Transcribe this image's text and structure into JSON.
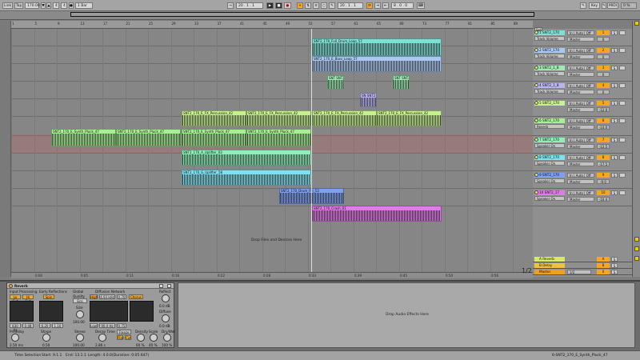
{
  "transport": {
    "link": "Link",
    "tap": "Tap",
    "tempo": "170.00",
    "sig_num": "4",
    "sig_den": "4",
    "quantize": "1 Bar",
    "position": "20 . 1 . 1",
    "loop_start": "20 . 1 . 1",
    "loop_len": "8 . 0 . 0",
    "key": "Key",
    "midi": "MIDI",
    "cpu": "0 %"
  },
  "ruler": {
    "bars": [
      "1",
      "5",
      "9",
      "13",
      "17",
      "21",
      "25",
      "29",
      "33",
      "37",
      "41",
      "45",
      "49",
      "53",
      "57",
      "61",
      "65",
      "69",
      "73",
      "77",
      "81",
      "85",
      "89"
    ],
    "times": [
      "0:00",
      "0:05",
      "0:11",
      "0:16",
      "0:22",
      "0:28",
      "0:33",
      "0:39",
      "0:45",
      "0:50",
      "0:56"
    ]
  },
  "clips": [
    {
      "name": "SNT2_170_Full_Drum_Loop_57",
      "color": "#7de0d4",
      "waveform": true
    },
    {
      "name": "SNT2_170_E_Bass_Loop_57",
      "color": "#a8c8f0",
      "waveform": true
    },
    {
      "name": "SNT SNT2",
      "color": "#9ee9b0",
      "waveform": true
    },
    {
      "name": "SNT SNT2",
      "color": "#9ee9b0",
      "waveform": true
    },
    {
      "name": "SN SNT2",
      "color": "#b7b4f0",
      "waveform": true
    },
    {
      "name": "SNT2_170_E_FX_Percussion_42",
      "color": "#c7f08e",
      "waveform": true
    },
    {
      "name": "SNT2_170_E_FX_Percussion_42",
      "color": "#c7f08e",
      "waveform": true
    },
    {
      "name": "SNT2_170_E_FX_Percussion_42",
      "color": "#c7f08e",
      "waveform": true
    },
    {
      "name": "SNT2_170_E_FX_Percussion_42",
      "color": "#c7f08e",
      "waveform": true
    },
    {
      "name": "SNT2_170_E_Synth_Pluck_47",
      "color": "#a8f096",
      "waveform": true
    },
    {
      "name": "SNT2_170_E_Synth_Pluck_47",
      "color": "#a8f096",
      "waveform": true
    },
    {
      "name": "SNT2_170_E_Synth_Pluck_47",
      "color": "#a8f096",
      "waveform": true
    },
    {
      "name": "SNT2_170_E_Synth_Pluck_47",
      "color": "#a8f096",
      "waveform": true
    },
    {
      "name": "SNT2_170_A_Uplifter_03",
      "color": "#8ef0b8",
      "waveform": true
    },
    {
      "name": "SNT2_170_G_Uplifter_58",
      "color": "#80e0f0",
      "waveform": true
    },
    {
      "name": "SNT2_170_Drum_Fill_53",
      "color": "#7f9ff0",
      "waveform": true
    },
    {
      "name": "SNT2_170_Crash_01",
      "color": "#e07ae8",
      "waveform": true
    }
  ],
  "drop_arrangement": "Drop Files and Devices Here",
  "tracks": [
    {
      "name": "1 SNT2_170",
      "color": "#7de0d4",
      "sub": "Track Volume",
      "io": "Master",
      "num": "1",
      "vol": "0"
    },
    {
      "name": "2 SNT2_170",
      "color": "#a8c8f0",
      "sub": "Track Volume",
      "io": "Master",
      "num": "2",
      "vol": "0"
    },
    {
      "name": "3 SNT2_1_8",
      "color": "#9ee9b0",
      "sub": "Track Volume",
      "io": "Master",
      "num": "3",
      "vol": "0"
    },
    {
      "name": "4 SNT2_1_8",
      "color": "#b7b4f0",
      "sub": "Track Volume",
      "io": "Master",
      "num": "4",
      "vol": "0"
    },
    {
      "name": "5 SNT2_170",
      "color": "#c7f08e",
      "sub": "",
      "io": "Master",
      "num": "5",
      "vol": "-12.0"
    },
    {
      "name": "6 SNT2_170",
      "color": "#a8f096",
      "sub": "Reverb",
      "io": "Master",
      "num": "6",
      "vol": "-14.0",
      "sub2": "Dry/Wet"
    },
    {
      "name": "7 SNT2_170",
      "color": "#8ef0b8",
      "sub": "Speaker On",
      "io": "Master",
      "num": "7",
      "vol": "-12.5"
    },
    {
      "name": "8 SNT2_170",
      "color": "#80e0f0",
      "sub": "Speaker On",
      "io": "Master",
      "num": "8",
      "vol": "-17.5"
    },
    {
      "name": "9 SNT2_170",
      "color": "#7f9ff0",
      "sub": "Speaker On",
      "io": "Master",
      "num": "9",
      "vol": "-9.0"
    },
    {
      "name": "10 SNT2_17",
      "color": "#e07ae8",
      "sub": "Speaker On",
      "io": "Master",
      "num": "10",
      "vol": "-10.4"
    }
  ],
  "track_io_in": "In",
  "track_io_auto": "Auto",
  "track_io_off": "Off",
  "set_label": "Set",
  "returns": [
    {
      "name": "A Reverb",
      "num": "A"
    },
    {
      "name": "B Delay",
      "num": "B"
    },
    {
      "name": "Master",
      "num": "0"
    }
  ],
  "master_io": "1/2",
  "pager": "1/2",
  "device": {
    "title": "Reverb",
    "input_processing": "Input Processing",
    "lo_cut": "Lo Cut",
    "hi_cut": "Hi Cut",
    "early_reflections": "Early Reflections",
    "spin": "Spin",
    "global": "Global",
    "quality": "Quality",
    "quality_val": "Eco",
    "size": "Size",
    "size_val": "100.00",
    "stereo": "Stereo",
    "stereo_val": "100.00",
    "diffusion_network": "Diffusion Network",
    "high": "High",
    "high_val": "4.93 kHz",
    "high_ratio": "0.70",
    "chorus": "Chorus",
    "low": "Low",
    "low_val": "90.0 Hz",
    "low_ratio": "0.75",
    "decay_time": "Decay Time",
    "decay_val": "2.86 s",
    "freeze": "Freeze",
    "flat": "Flat",
    "cut": "Cut",
    "density": "Density",
    "density_val": "60 %",
    "scale": "Scale",
    "scale_val": "40 %",
    "reflect": "Reflect",
    "reflect_val": "0.0 dB",
    "diffuse": "Diffuse",
    "diffuse_val": "0.0 dB",
    "dry_wet": "Dry/Wet",
    "dry_wet_val": "100 %",
    "predelay": "Predelay",
    "predelay_val": "2.50 ms",
    "shape": "Shape",
    "shape_val": "0.50",
    "locut_freq": "830 Hz",
    "locut_q": "0.48",
    "hicut_freq": "6.20",
    "hicut_q": "1.10"
  },
  "drop_effects": "Drop Audio Effects Here",
  "status": {
    "time_selection": "Time Selection",
    "start": "Start: 9.1.1",
    "end": "End: 13.1.1",
    "length": "Length: 4.0.0",
    "duration": "(Duration: 0:05.647)",
    "selected_clip": "6-SNT2_170_E_Synth_Pluck_47"
  }
}
